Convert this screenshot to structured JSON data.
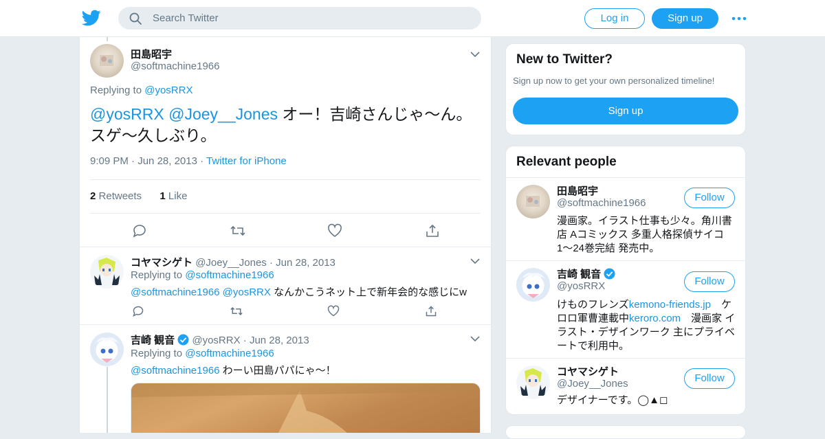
{
  "header": {
    "search_placeholder": "Search Twitter",
    "login_label": "Log in",
    "signup_label": "Sign up"
  },
  "colors": {
    "accent": "#1da1f2",
    "link": "#1b95e0",
    "muted": "#657786",
    "verified": "#1da1f2"
  },
  "main_tweet": {
    "name": "田島昭宇",
    "handle": "@softmachine1966",
    "replying_prefix": "Replying to",
    "replying_to": "@yosRRX",
    "mention1": "@yosRRX",
    "mention2": "@Joey__Jones",
    "text": " オー！吉崎さんじゃ～ん。スゲ～久しぶり。",
    "time": "9:09 PM",
    "date": "Jun 28, 2013",
    "source": "Twitter for iPhone",
    "retweet_count": "2",
    "retweet_label": "Retweets",
    "like_count": "1",
    "like_label": "Like"
  },
  "replies": [
    {
      "name": "コヤマシゲト",
      "handle": "@Joey__Jones",
      "date": "Jun 28, 2013",
      "replying_prefix": "Replying to",
      "replying_to": "@softmachine1966",
      "mention1": "@softmachine1966",
      "mention2": "@yosRRX",
      "text": " なんかこうネット上で新年会的な感じにw"
    },
    {
      "name": "吉崎 観音",
      "handle": "@yosRRX",
      "date": "Jun 28, 2013",
      "replying_prefix": "Replying to",
      "replying_to": "@softmachine1966",
      "mention1": "@softmachine1966",
      "text": " わーい田島パパにゃ〜！"
    }
  ],
  "sidebar": {
    "new_title": "New to Twitter?",
    "new_sub": "Sign up now to get your own personalized timeline!",
    "new_signup": "Sign up",
    "relevant_title": "Relevant people",
    "follow_label": "Follow",
    "people": [
      {
        "name": "田島昭宇",
        "handle": "@softmachine1966",
        "bio": "漫画家。イラスト仕事も少々。角川書店 Aコミックス 多重人格探偵サイコ 1〜24巻完結 発売中。"
      },
      {
        "name": "吉崎 観音",
        "handle": "@yosRRX",
        "bio_a": "けものフレンズ",
        "bio_link1": "kemono-friends.jp",
        "bio_b": "　ケロロ軍曹連載中",
        "bio_link2": "keroro.com",
        "bio_c": "　漫画家 イラスト・デザインワーク 主にプライベートで利用中。"
      },
      {
        "name": "コヤマシゲト",
        "handle": "@Joey__Jones",
        "bio": "デザイナーです。◯▲◻"
      }
    ]
  }
}
